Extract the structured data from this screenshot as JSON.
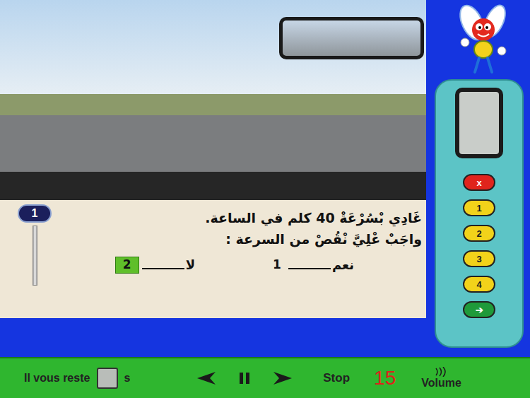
{
  "question": {
    "number": "1",
    "lines": [
      "غَادِي بْسُرْعَةْ 40 كلم في الساعة.",
      "واجَبْ عْلِيَّ نْقُصْ من السرعة :"
    ],
    "options": [
      {
        "label": "نعم",
        "number": "1",
        "selected": false
      },
      {
        "label": "لا",
        "number": "2",
        "selected": true
      }
    ]
  },
  "remote": {
    "buttons": [
      {
        "label": "x",
        "kind": "cancel"
      },
      {
        "label": "1",
        "kind": "number"
      },
      {
        "label": "2",
        "kind": "number"
      },
      {
        "label": "3",
        "kind": "number"
      },
      {
        "label": "4",
        "kind": "number"
      },
      {
        "label": "➔",
        "kind": "next"
      }
    ]
  },
  "bottom_bar": {
    "timer_label": "Il vous reste",
    "timer_unit": "s",
    "stop_label": "Stop",
    "count": "15",
    "volume_label": "Volume"
  }
}
